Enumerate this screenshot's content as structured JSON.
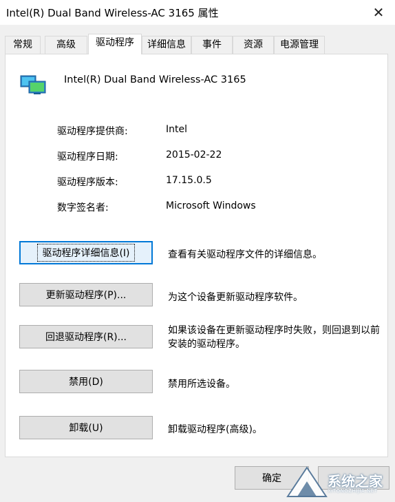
{
  "window": {
    "title": "Intel(R) Dual Band Wireless-AC 3165 属性",
    "close_glyph": "✕"
  },
  "tabs": [
    {
      "label": "常规"
    },
    {
      "label": "高级"
    },
    {
      "label": "驱动程序",
      "active": true
    },
    {
      "label": "详细信息"
    },
    {
      "label": "事件"
    },
    {
      "label": "资源"
    },
    {
      "label": "电源管理"
    }
  ],
  "device": {
    "name": "Intel(R) Dual Band Wireless-AC 3165",
    "icon": "network-adapter-icon"
  },
  "driver_info": [
    {
      "label": "驱动程序提供商:",
      "value": "Intel"
    },
    {
      "label": "驱动程序日期:",
      "value": "2015-02-22"
    },
    {
      "label": "驱动程序版本:",
      "value": "17.15.0.5"
    },
    {
      "label": "数字签名者:",
      "value": "Microsoft Windows"
    }
  ],
  "actions": [
    {
      "button": "驱动程序详细信息(I)",
      "description": "查看有关驱动程序文件的详细信息。"
    },
    {
      "button": "更新驱动程序(P)...",
      "description": "为这个设备更新驱动程序软件。"
    },
    {
      "button": "回退驱动程序(R)...",
      "description": "如果该设备在更新驱动程序时失败，则回退到以前安装的驱动程序。"
    },
    {
      "button": "禁用(D)",
      "description": "禁用所选设备。"
    },
    {
      "button": "卸载(U)",
      "description": "卸载驱动程序(高级)。"
    }
  ],
  "footer": {
    "ok_label": "确定"
  },
  "watermark": {
    "text": "系统之家",
    "sub": "XITONGZHIJIA.NET"
  },
  "colors": {
    "focus_border": "#0078d7",
    "button_bg": "#e1e1e1",
    "dialog_bg": "#f0f0f0"
  }
}
